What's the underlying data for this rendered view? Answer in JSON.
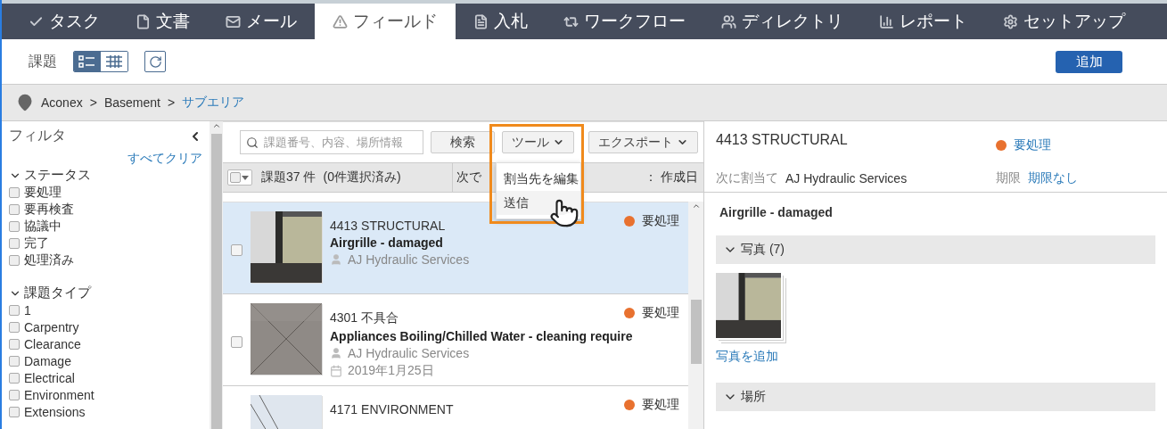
{
  "nav_tabs": [
    {
      "label": "タスク",
      "selected": false
    },
    {
      "label": "文書",
      "selected": false
    },
    {
      "label": "メール",
      "selected": false
    },
    {
      "label": "フィールド",
      "selected": true
    },
    {
      "label": "入札",
      "selected": false
    },
    {
      "label": "ワークフロー",
      "selected": false
    },
    {
      "label": "ディレクトリ",
      "selected": false
    },
    {
      "label": "レポート",
      "selected": false
    },
    {
      "label": "セットアップ",
      "selected": false
    }
  ],
  "subheader": {
    "title": "課題",
    "view_toggle": [
      {
        "selected": true
      },
      {
        "selected": false
      }
    ],
    "add_button": "追加"
  },
  "breadcrumb": {
    "items": [
      "Aconex",
      "Basement"
    ],
    "separator": ">",
    "current": "サブエリア"
  },
  "filter": {
    "title": "フィルタ",
    "clear_all": "すべてクリア",
    "sections": [
      {
        "title": "ステータス",
        "expanded": true,
        "items": [
          {
            "label": "要処理",
            "checked": false
          },
          {
            "label": "要再検査",
            "checked": false
          },
          {
            "label": "協議中",
            "checked": false
          },
          {
            "label": "完了",
            "checked": false
          },
          {
            "label": "処理済み",
            "checked": false
          }
        ]
      },
      {
        "title": "課題タイプ",
        "expanded": true,
        "items": [
          {
            "label": "1",
            "checked": false
          },
          {
            "label": "Carpentry",
            "checked": false
          },
          {
            "label": "Clearance",
            "checked": false
          },
          {
            "label": "Damage",
            "checked": false
          },
          {
            "label": "Electrical",
            "checked": false
          },
          {
            "label": "Environment",
            "checked": false
          },
          {
            "label": "Extensions",
            "checked": false
          }
        ]
      }
    ]
  },
  "toolbar": {
    "search": {
      "placeholder": "課題番号、内容、場所情報"
    },
    "search_button": "検索",
    "tools_button": "ツール",
    "export_button": "エクスポート"
  },
  "tools_menu": {
    "items": [
      {
        "label": "割当先を編集",
        "selected": false
      },
      {
        "label": "送信",
        "selected": true
      }
    ]
  },
  "summary": {
    "count": "課題37 件",
    "selected_count": "(0件選択済み)",
    "sort_prefix": "次で",
    "sort_value": "： 作成日"
  },
  "issues": [
    {
      "number": "4413",
      "type": "STRUCTURAL",
      "title": "Airgrille - damaged",
      "assignee": "AJ Hydraulic Services",
      "status": "要処理",
      "color": "#e8712f",
      "selected": true,
      "checked": false
    },
    {
      "number": "4301",
      "type": "不具合",
      "title": "Appliances Boiling/Chilled Water - cleaning require",
      "assignee": "AJ Hydraulic Services",
      "date": "2019年1月25日",
      "status": "要処理",
      "color": "#e8712f",
      "selected": false,
      "checked": false
    },
    {
      "number": "4171",
      "type": "ENVIRONMENT",
      "status": "要処理",
      "color": "#e8712f",
      "selected": false
    }
  ],
  "detail": {
    "number": "4413",
    "type": "STRUCTURAL",
    "status": "要処理",
    "color": "#e8712f",
    "assign_label": "次に割当て",
    "assignee": "AJ Hydraulic Services",
    "due_label": "期限",
    "due_value": "期限なし",
    "title": "Airgrille - damaged",
    "sections": [
      {
        "title": "写真 (7)",
        "expanded": true
      },
      {
        "title": "場所",
        "expanded": true
      }
    ],
    "add_photo": "写真を追加"
  }
}
